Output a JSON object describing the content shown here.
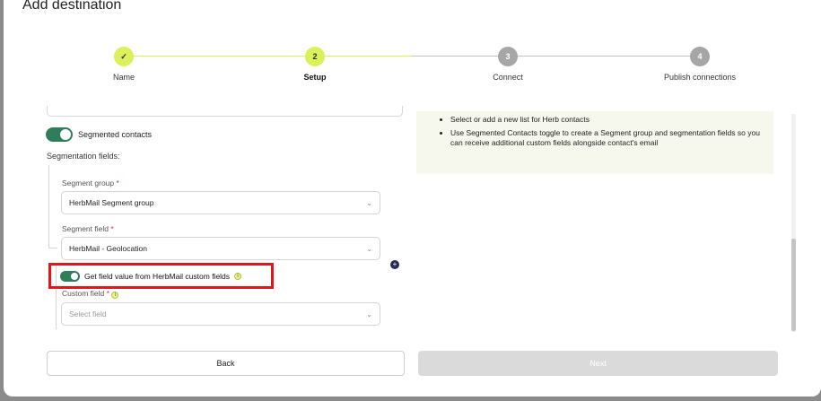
{
  "dialog": {
    "title": "Add destination"
  },
  "stepper": {
    "steps": [
      {
        "number": "",
        "label": "Name",
        "state": "done"
      },
      {
        "number": "2",
        "label": "Setup",
        "state": "active"
      },
      {
        "number": "3",
        "label": "Connect",
        "state": "todo"
      },
      {
        "number": "4",
        "label": "Publish connections",
        "state": "todo"
      }
    ],
    "colors": {
      "done": "#dbf05a",
      "todo": "#a6a6a6",
      "line_done": "#dbf05a",
      "line_todo": "#bdbdbd"
    }
  },
  "form": {
    "segmented_toggle_label": "Segmented contacts",
    "segmented_toggle_on": true,
    "segmentation_fields_label": "Segmentation fields:",
    "segment_group": {
      "label": "Segment group",
      "required_mark": "*",
      "value": "HerbMail Segment group"
    },
    "segment_field": {
      "label": "Segment field",
      "required_mark": "*",
      "value": "HerbMail - Geolocation"
    },
    "custom_toggle_label": "Get field value from HerbMail custom fields",
    "custom_toggle_on": true,
    "custom_field": {
      "label": "Custom field",
      "required_mark": "*",
      "placeholder": "Select field"
    },
    "info_glyph": "i",
    "add_glyph": "+"
  },
  "help": {
    "items": [
      "Select or add a new list for Herb contacts",
      "Use Segmented Contacts toggle to create a Segment group and segmentation fields so you can receive additional custom fields alongside contact's email"
    ]
  },
  "footer": {
    "back_label": "Back",
    "next_label": "Next"
  },
  "colors": {
    "accent_green": "#2e7d5b",
    "highlight_red": "#e4141b",
    "required_red": "#d0302f"
  }
}
